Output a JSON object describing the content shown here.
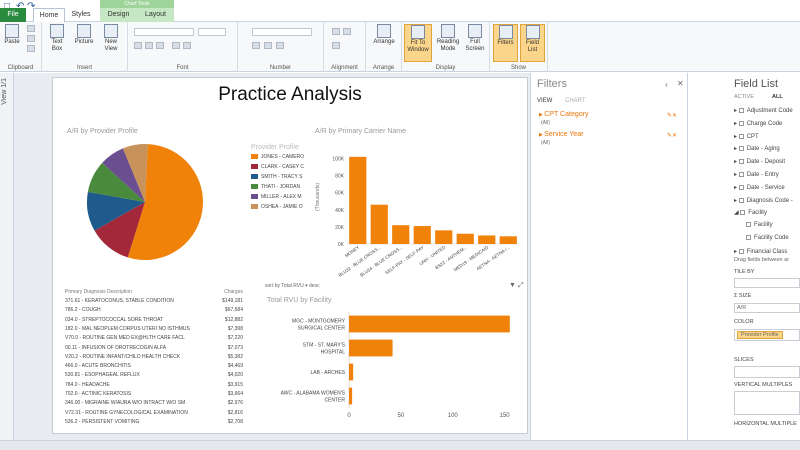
{
  "tabs": {
    "file": "File",
    "home": "Home",
    "styles": "Styles",
    "chart_tools": "Chart Tools",
    "design": "Design",
    "layout": "Layout"
  },
  "ribbon": {
    "paste": "Paste",
    "clipboard": "Clipboard",
    "text_box": "Text Box",
    "picture": "Picture",
    "new_view": "New View",
    "insert": "Insert",
    "font": "Font",
    "number": "Number",
    "alignment": "Alignment",
    "arrange_btn": "Arrange",
    "arrange": "Arrange",
    "fit_to_window": "Fit To Window",
    "reading_mode": "Reading Mode",
    "full_screen": "Full Screen",
    "display": "Display",
    "filters_btn": "Filters",
    "field_list_btn": "Field List",
    "show": "Show"
  },
  "side": {
    "view_label": "View 1/1"
  },
  "report": {
    "title": "Practice Analysis"
  },
  "pie": {
    "title": "A/R by Provider Profile",
    "legend_title": "Provider Profile",
    "legend": [
      "JONES - CAMERO",
      "CLARK - CASEY C",
      "SMITH - TRACY S",
      "THATI - JORDAN",
      "MILLER - ALEX M",
      "OSHEA - JAMIE O"
    ],
    "colors": [
      "#f0820a",
      "#a2283a",
      "#1f5a8c",
      "#4a8a3c",
      "#6a4e8f",
      "#c8935a"
    ]
  },
  "carrier": {
    "title": "A/R by Primary Carrier Name",
    "ylabel": "(Thousands)"
  },
  "table": {
    "header_desc": "Primary Diagnosis Description",
    "header_charges": "Charges",
    "rows": [
      {
        "d": "371.61 - KERATOCONUS, STABLE CONDITION",
        "c": "$149,181"
      },
      {
        "d": "786.2 - COUGH",
        "c": "$67,584"
      },
      {
        "d": "034.0 - STREPTOCOCCAL SORE THROAT",
        "c": "$12,882"
      },
      {
        "d": "182.0 - MAL NEOPLEM CORPUS UTERI NO ISTHMUS",
        "c": "$7,398"
      },
      {
        "d": "V70.0 - ROUTINE GEN MED EX@HLTH CARE FACL",
        "c": "$7,220"
      },
      {
        "d": "00.11 - INFUSION OF DROTRECOGIN ALFA",
        "c": "$7,073"
      },
      {
        "d": "V20.2 - ROUTINE INFANT/CHILD HEALTH CHECK",
        "c": "$5,382"
      },
      {
        "d": "466.0 - ACUTE BRONCHITIS",
        "c": "$4,469"
      },
      {
        "d": "530.81 - ESOPHAGEAL REFLUX",
        "c": "$4,020"
      },
      {
        "d": "784.0 - HEADACHE",
        "c": "$3,915"
      },
      {
        "d": "702.0 - ACTINIC KERATOSIS",
        "c": "$3,664"
      },
      {
        "d": "346.00 - MIGRAINE W/AURA W/O INTRACT W/O SM",
        "c": "$2,976"
      },
      {
        "d": "V72.31 - ROUTINE GYNECOLOGICAL EXAMINATION",
        "c": "$2,816"
      },
      {
        "d": "536.2 - PERSISTENT VOMITING",
        "c": "$2,708"
      }
    ]
  },
  "rvu": {
    "title": "Total RVU by Facility",
    "sort_text": "sort by  Total RVU  ▾  desc"
  },
  "chart_data": [
    {
      "type": "pie",
      "title": "A/R by Provider Profile",
      "categories": [
        "JONES - CAMERO",
        "CLARK - CASEY C",
        "SMITH - TRACY S",
        "THATI - JORDAN",
        "MILLER - ALEX M",
        "OSHEA - JAMIE O"
      ],
      "values": [
        54,
        12,
        11,
        9,
        7,
        7
      ]
    },
    {
      "type": "bar",
      "title": "A/R by Primary Carrier Name",
      "ylabel": "(Thousands)",
      "categories": [
        "MONEY",
        "BLU32 - BLUE CROSS...",
        "BLU34 - BLUE CROSS...",
        "SELF-PAY - SELF-PAY",
        "UNH - UNITED",
        "BS22 - ANTHEM...",
        "MED19 - MEDICAID",
        "AETNA - AETNA /..."
      ],
      "values": [
        102,
        46,
        22,
        21,
        16,
        12,
        10,
        9
      ],
      "yticks": [
        "0K",
        "20K",
        "40K",
        "60K",
        "80K",
        "100K"
      ],
      "ylim": [
        0,
        110
      ],
      "color": "#f0820a"
    },
    {
      "type": "bar",
      "orientation": "horizontal",
      "title": "Total RVU by Facility",
      "categories": [
        "MGC - MONTGOMERY SURGICAL CENTER",
        "STM - ST. MARY'S HOSPITAL",
        "LAB - ARCHES",
        "AWC - ALABAMA WOMEN'S CENTER"
      ],
      "values": [
        155,
        42,
        4,
        3
      ],
      "xticks": [
        "0",
        "50",
        "100",
        "150"
      ],
      "xlim": [
        0,
        160
      ],
      "color": "#f0820a"
    }
  ],
  "filters": {
    "title": "Filters",
    "tab_view": "VIEW",
    "tab_chart": "CHART",
    "items": [
      {
        "label": "CPT Category",
        "sub": "(All)"
      },
      {
        "label": "Service Year",
        "sub": "(All)"
      }
    ]
  },
  "field_list": {
    "title": "Field List",
    "tab_active": "ACTIVE",
    "tab_all": "ALL",
    "items": [
      "Adjustment Code",
      "Charge Code",
      "CPT",
      "Date - Aging",
      "Date - Deposit",
      "Date - Entry",
      "Date - Service",
      "Diagnosis Code -",
      "Facility",
      "Facility",
      "Facility Code",
      "Financial Class"
    ],
    "drag_hint": "Drag fields between ar",
    "tile_by": "TILE BY",
    "size": "Σ SIZE",
    "size_value": "A/R",
    "color": "COLOR",
    "color_value": "Provider Profile",
    "slices": "SLICES",
    "vertical_multiples": "VERTICAL MULTIPLES",
    "horizontal_multiples": "HORIZONTAL MULTIPLE"
  }
}
